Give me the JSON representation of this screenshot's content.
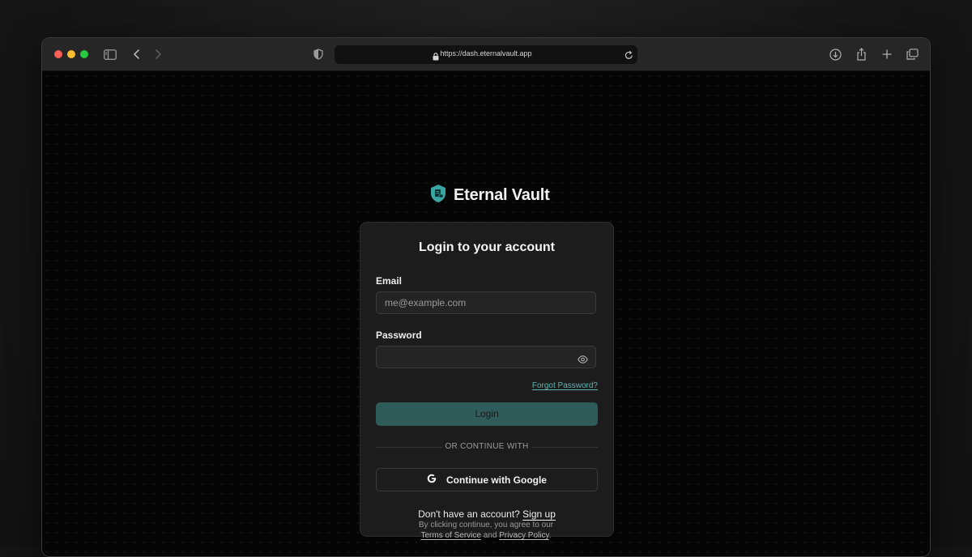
{
  "browser": {
    "url": "https://dash.eternalvault.app",
    "icons": [
      "sidebar-icon",
      "back-icon",
      "forward-icon",
      "shield-icon",
      "lock-icon",
      "reload-icon",
      "download-icon",
      "share-icon",
      "new-tab-icon",
      "tabs-overview-icon"
    ]
  },
  "brand": {
    "name": "Eternal Vault",
    "accent": "#3aa5a3"
  },
  "login": {
    "title": "Login to your account",
    "email_label": "Email",
    "email_placeholder": "me@example.com",
    "email_value": "",
    "password_label": "Password",
    "password_value": "",
    "forgot_label": "Forgot Password?",
    "login_label": "Login",
    "divider_label": "OR CONTINUE WITH",
    "google_label": "Continue with Google",
    "signup_prompt": "Don't have an account?",
    "signup_label": "Sign up"
  },
  "legal": {
    "line1": "By clicking continue, you agree to our",
    "terms_label": "Terms of Service",
    "and_text": "and",
    "privacy_label": "Privacy Policy",
    "end_text": "."
  },
  "colors": {
    "login_button": "#2f5b59",
    "link": "#5fb3b0",
    "card_bg": "#1c1c1c"
  }
}
